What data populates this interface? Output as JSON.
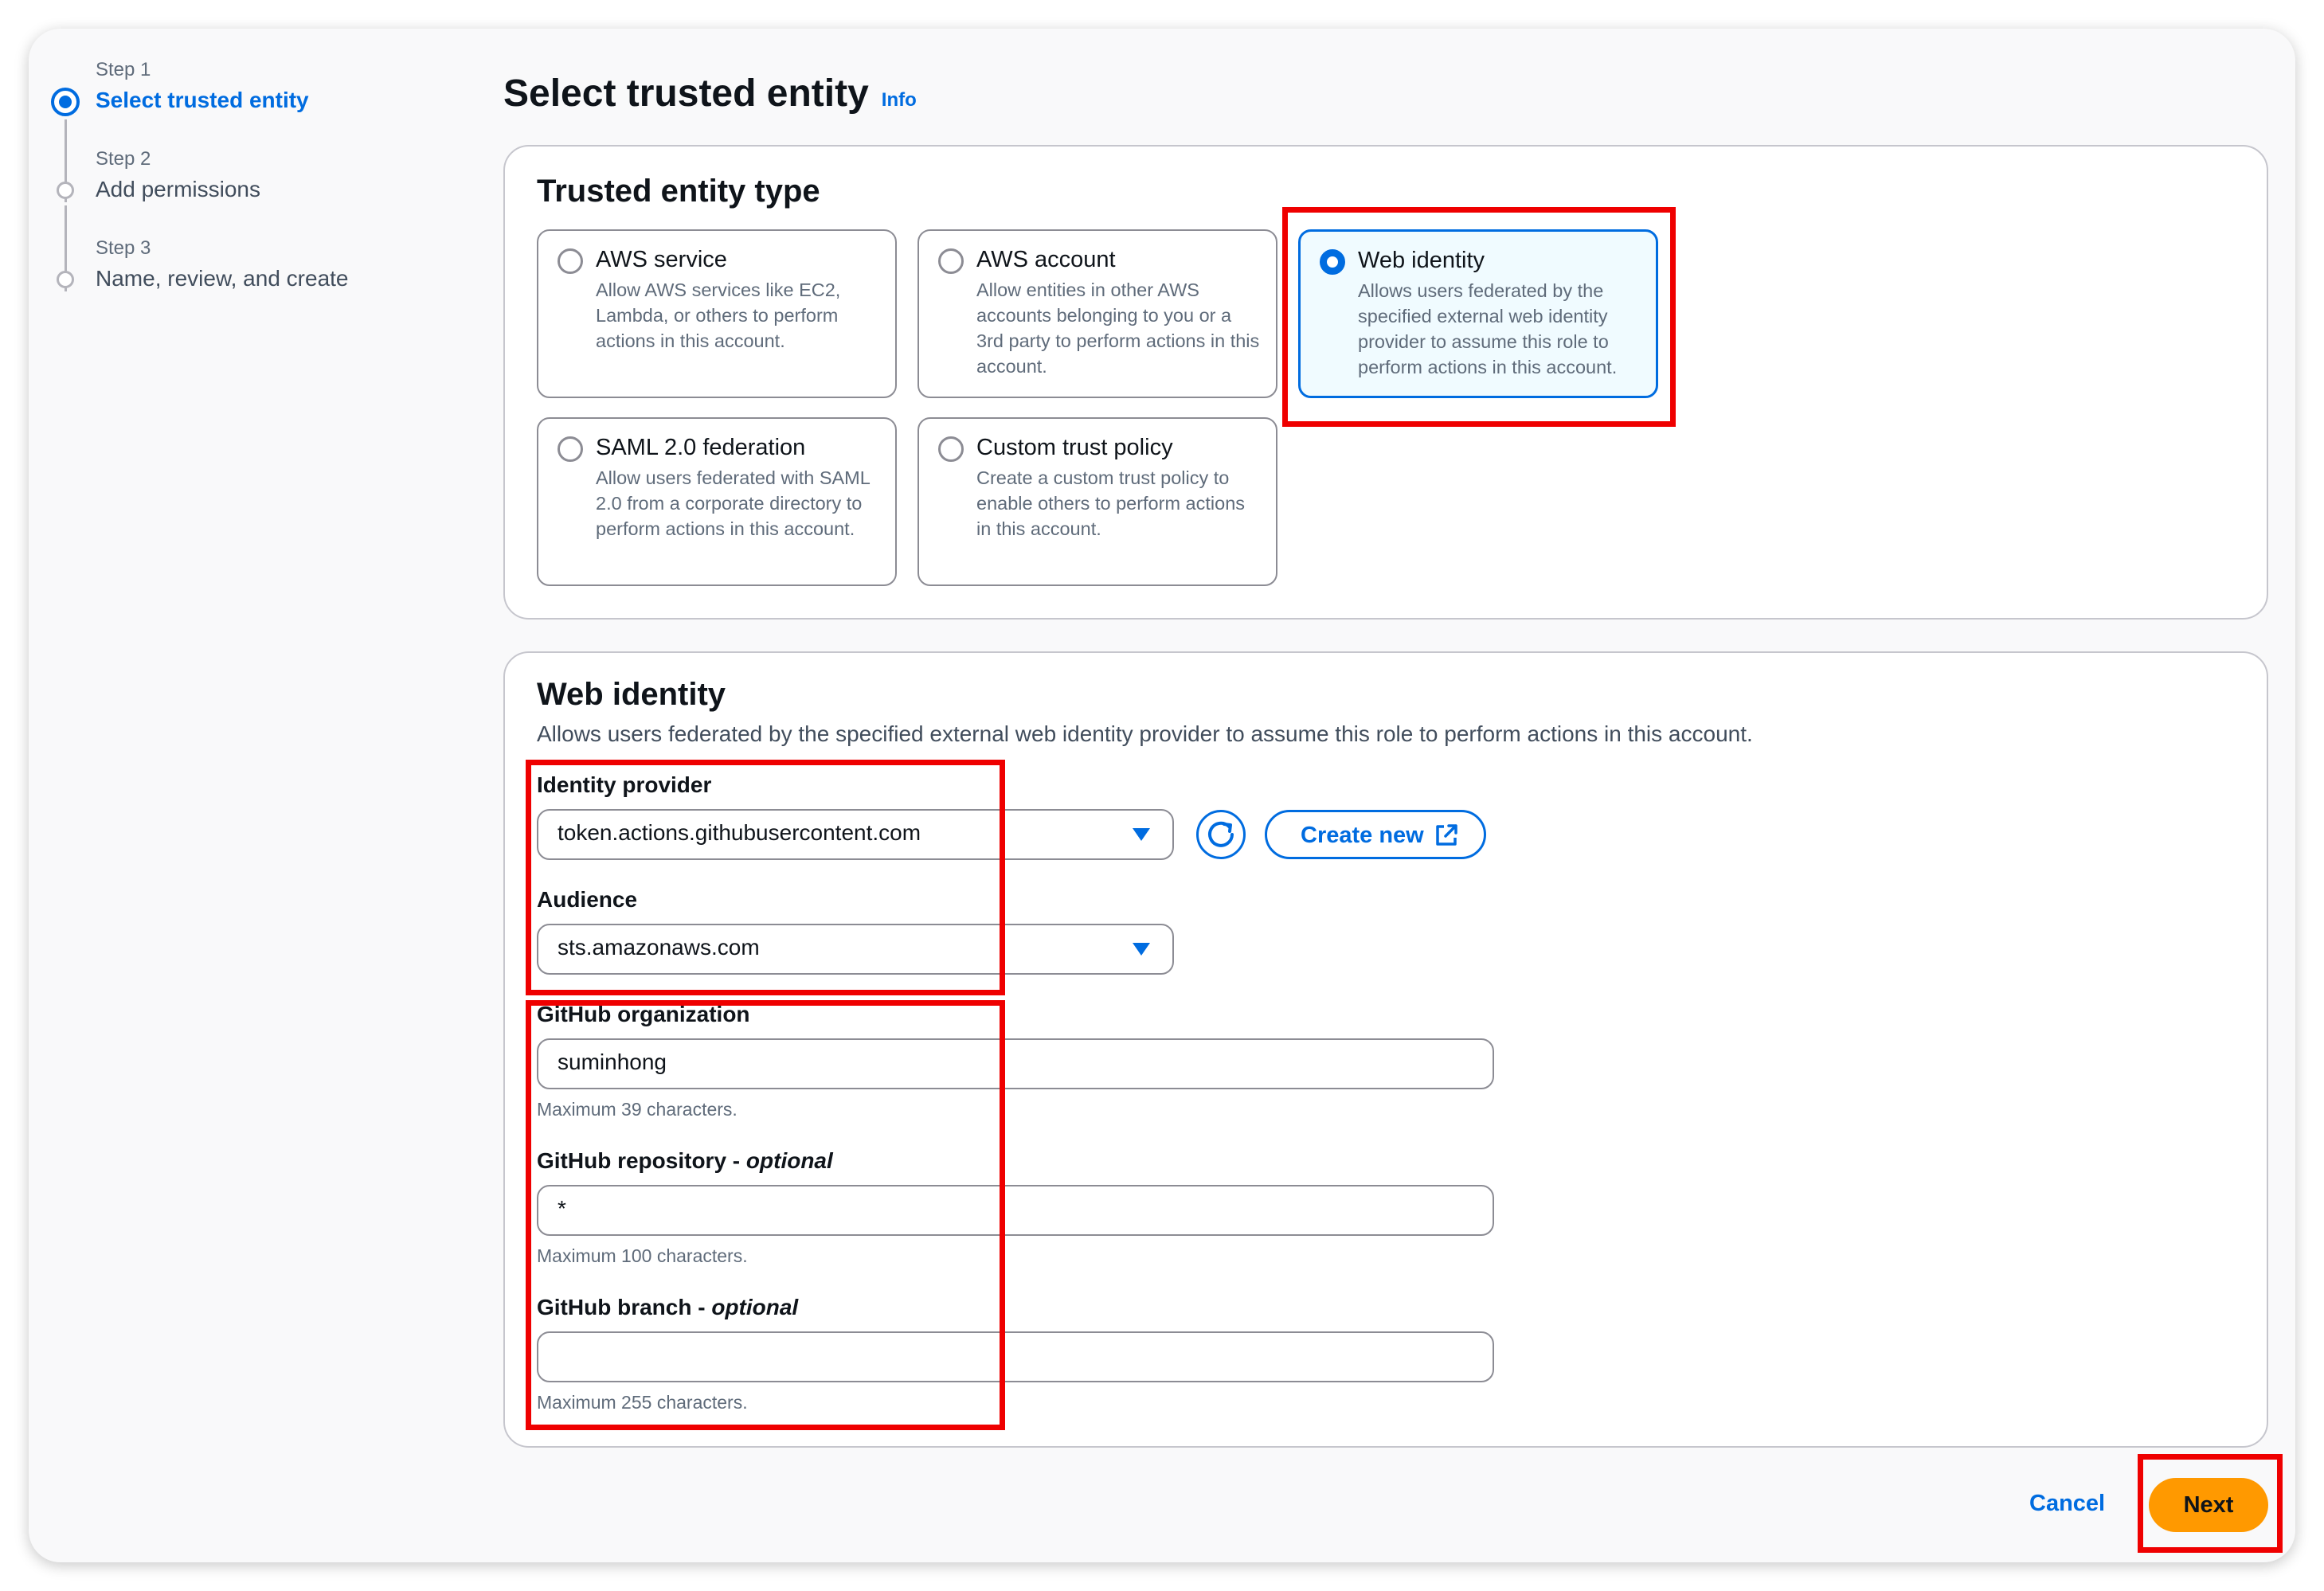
{
  "wizard": {
    "steps": [
      {
        "step": "Step 1",
        "label": "Select trusted entity"
      },
      {
        "step": "Step 2",
        "label": "Add permissions"
      },
      {
        "step": "Step 3",
        "label": "Name, review, and create"
      }
    ]
  },
  "header": {
    "title": "Select trusted entity",
    "info": "Info"
  },
  "entity_type": {
    "heading": "Trusted entity type",
    "selected": "Web identity",
    "options": [
      {
        "title": "AWS service",
        "desc": "Allow AWS services like EC2, Lambda, or others to perform actions in this account."
      },
      {
        "title": "AWS account",
        "desc": "Allow entities in other AWS accounts belonging to you or a 3rd party to perform actions in this account."
      },
      {
        "title": "Web identity",
        "desc": "Allows users federated by the specified external web identity provider to assume this role to perform actions in this account."
      },
      {
        "title": "SAML 2.0 federation",
        "desc": "Allow users federated with SAML 2.0 from a corporate directory to perform actions in this account."
      },
      {
        "title": "Custom trust policy",
        "desc": "Create a custom trust policy to enable others to perform actions in this account."
      }
    ]
  },
  "web_identity": {
    "heading": "Web identity",
    "description": "Allows users federated by the specified external web identity provider to assume this role to perform actions in this account.",
    "identity_provider": {
      "label": "Identity provider",
      "value": "token.actions.githubusercontent.com"
    },
    "create_new": "Create new",
    "audience": {
      "label": "Audience",
      "value": "sts.amazonaws.com"
    },
    "org": {
      "label": "GitHub organization",
      "value": "suminhong",
      "hint": "Maximum 39 characters."
    },
    "repo": {
      "label": "GitHub repository",
      "optional": "optional",
      "value": "*",
      "hint": "Maximum 100 characters."
    },
    "branch": {
      "label": "GitHub branch",
      "optional": "optional",
      "value": "",
      "hint": "Maximum 255 characters."
    }
  },
  "footer": {
    "cancel": "Cancel",
    "next": "Next"
  },
  "colors": {
    "accent": "#006ce0",
    "primary_button": "#ff9900",
    "highlight": "#ef0000"
  }
}
